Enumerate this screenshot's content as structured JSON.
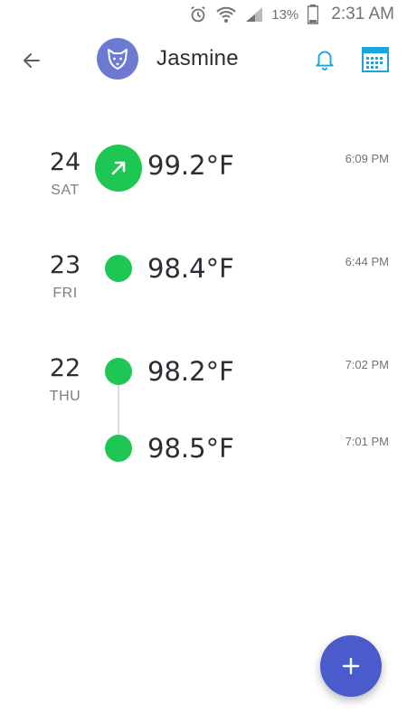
{
  "status_bar": {
    "icons": [
      "alarm-icon",
      "wifi-icon",
      "signal-icon",
      "battery-icon"
    ],
    "battery": "13%",
    "time": "2:31 AM"
  },
  "header": {
    "profile_name": "Jasmine",
    "avatar_icon": "fox-face-icon",
    "accent_color": "#1ba5e0",
    "avatar_color": "#6d7ad1"
  },
  "entries": [
    {
      "day": "24",
      "weekday": "SAT",
      "temp": "99.2°F",
      "time": "6:09 PM",
      "marker": "trend-up-arrow-icon"
    },
    {
      "day": "23",
      "weekday": "FRI",
      "temp": "98.4°F",
      "time": "6:44 PM"
    },
    {
      "day": "22",
      "weekday": "THU",
      "temp": "98.2°F",
      "time": "7:02 PM"
    },
    {
      "temp": "98.5°F",
      "time": "7:01 PM"
    }
  ],
  "colors": {
    "dot_green": "#1ec653",
    "fab": "#4a5bcc"
  },
  "fab": {
    "label": "+"
  }
}
